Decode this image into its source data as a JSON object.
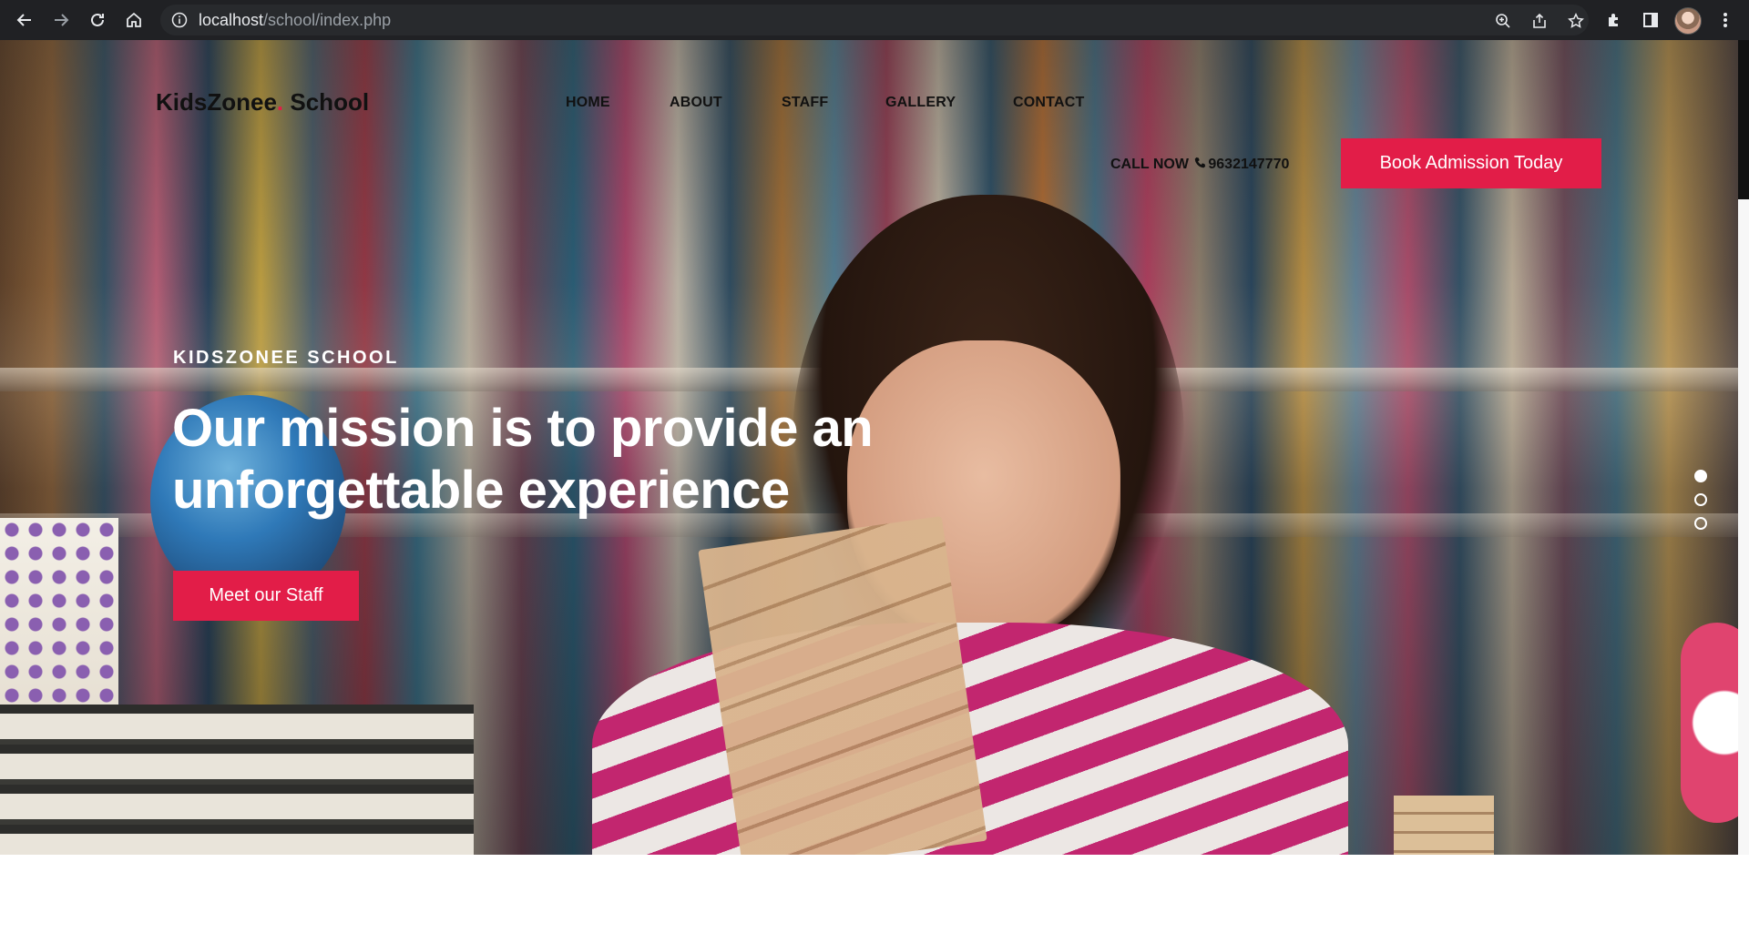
{
  "browser": {
    "url_host": "localhost",
    "url_path": "/school/index.php"
  },
  "site": {
    "logo_part1": "KidsZonee",
    "logo_dot": ".",
    "logo_part2": " School",
    "nav": [
      {
        "label": "HOME"
      },
      {
        "label": "ABOUT"
      },
      {
        "label": "STAFF"
      },
      {
        "label": "GALLERY"
      },
      {
        "label": "CONTACT"
      }
    ],
    "call_prefix": "CALL NOW",
    "phone": "9632147770",
    "book_button": "Book Admission Today"
  },
  "hero": {
    "eyebrow": "KIDSZONEE SCHOOL",
    "headline": "Our mission is to provide an unforgettable experience",
    "cta": "Meet our Staff",
    "slides_count": 3,
    "active_slide": 1
  },
  "colors": {
    "accent": "#e21d48"
  }
}
